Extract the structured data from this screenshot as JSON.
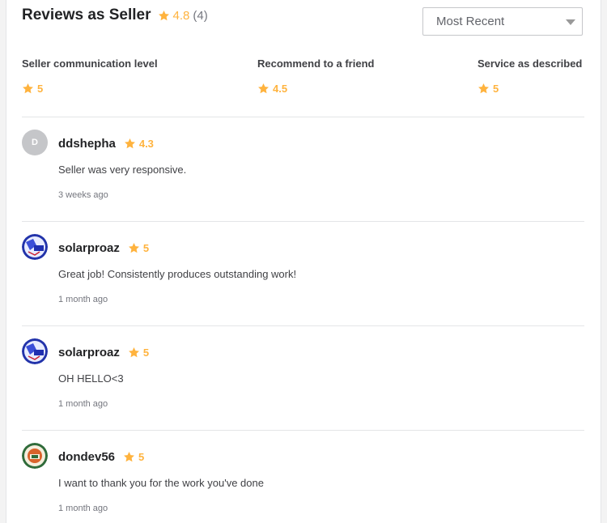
{
  "header": {
    "title": "Reviews as Seller",
    "rating": "4.8",
    "count": "(4)"
  },
  "sort": {
    "selected": "Most Recent"
  },
  "breakdown": [
    {
      "label": "Seller communication level",
      "value": "5"
    },
    {
      "label": "Recommend to a friend",
      "value": "4.5"
    },
    {
      "label": "Service as described",
      "value": "5"
    }
  ],
  "reviews": [
    {
      "avatar_letter": "D",
      "avatar_type": "letter",
      "username": "ddshepha",
      "rating": "4.3",
      "text": "Seller was very responsive.",
      "time": "3 weeks ago"
    },
    {
      "avatar_type": "image-blue",
      "username": "solarproaz",
      "rating": "5",
      "text": "Great job! Consistently produces outstanding work!",
      "time": "1 month ago"
    },
    {
      "avatar_type": "image-blue",
      "username": "solarproaz",
      "rating": "5",
      "text": "OH HELLO<3",
      "time": "1 month ago"
    },
    {
      "avatar_type": "image-logo",
      "username": "dondev56",
      "rating": "5",
      "text": "I want to thank you for the work you've done",
      "time": "1 month ago"
    }
  ],
  "icons": {
    "star": "star-icon",
    "dropdown": "chevron-down-icon"
  },
  "colors": {
    "star": "#ffb33e",
    "text": "#222325",
    "muted": "#74767e"
  }
}
